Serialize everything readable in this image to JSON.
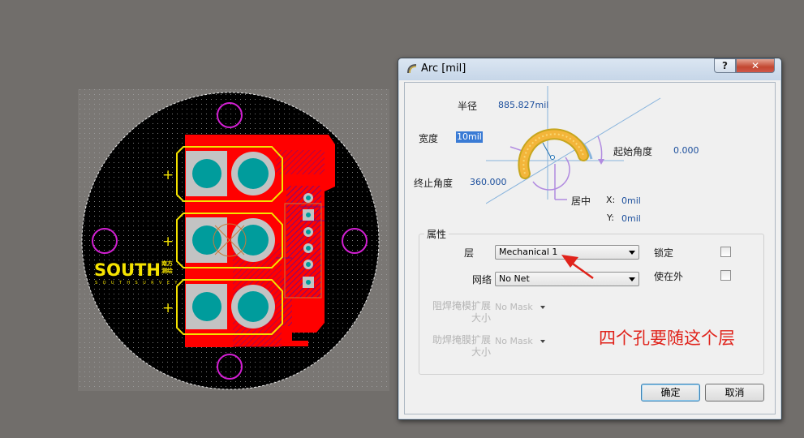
{
  "pcb": {
    "logo_text": "SOUTH",
    "logo_badge": "南方测绘",
    "logo_subtext": "S O U T H   S U R V E Y",
    "silkscreen_marks": [
      "+",
      "+",
      "+"
    ],
    "colors": {
      "board": "#000000",
      "copper": "#ff0000",
      "silkscreen": "#f5e300",
      "pad": "#c0c0c0",
      "hole": "#00a0a0",
      "mechanical": "#d21fd2"
    }
  },
  "dialog": {
    "title": "Arc [mil]",
    "help_label": "?",
    "close_label": "✕",
    "radius_label": "半径",
    "radius_value": "885.827mil",
    "width_label": "宽度",
    "width_value": "10mil",
    "end_angle_label": "终止角度",
    "end_angle_value": "360.000",
    "start_angle_label": "起始角度",
    "start_angle_value": "0.000",
    "center_label": "居中",
    "center_x_label": "X:",
    "center_x_value": "0mil",
    "center_y_label": "Y:",
    "center_y_value": "0mil",
    "properties_group": "属性",
    "layer_label": "层",
    "layer_value": "Mechanical 1",
    "net_label": "网络",
    "net_value": "No Net",
    "locked_label": "锁定",
    "locked_checked": false,
    "keepout_label": "使在外",
    "keepout_checked": false,
    "solder_mask_label": "阻焊掩模扩展大小",
    "solder_mask_value": "No Mask",
    "paste_mask_label": "助焊掩膜扩展大小",
    "paste_mask_value": "No Mask",
    "ok_label": "确定",
    "cancel_label": "取消"
  },
  "annotation": {
    "text": "四个孔要随这个层",
    "color": "#e0231b"
  }
}
